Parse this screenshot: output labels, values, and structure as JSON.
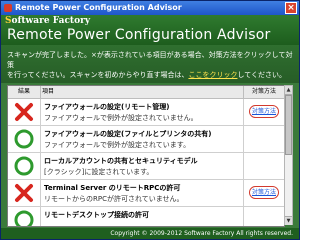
{
  "window": {
    "title": "Remote Power Configuration Advisor",
    "close_glyph": "×"
  },
  "header": {
    "brand_mark": "S",
    "brand_rest": "oftware Factory",
    "title": "Remote Power Configuration Advisor"
  },
  "intro": {
    "line1": "スキャンが完了しました。×が表示されている項目がある場合、対策方法をクリックして対策",
    "line2_prefix": "を行ってください。スキャンを初めからやり直す場合は、",
    "link": "ここをクリック",
    "line2_suffix": "してください。"
  },
  "table": {
    "headers": {
      "result": "結果",
      "item": "項目",
      "action": "対策方法"
    },
    "rows": [
      {
        "status": "fail",
        "name": "ファイアウォールの設定(リモート管理)",
        "detail": "ファイアウォールで例外が設定されていません。",
        "action": "対策方法"
      },
      {
        "status": "ok",
        "name": "ファイアウォールの設定(ファイルとプリンタの共有)",
        "detail": "ファイアウォールで例外が設定されています。",
        "action": ""
      },
      {
        "status": "ok",
        "name": "ローカルアカウントの共有とセキュリティモデル",
        "detail": "[クラシック]に設定されています。",
        "action": ""
      },
      {
        "status": "fail",
        "name": "Terminal Server のリモートRPCの許可",
        "detail": "リモートからのRPCが許可されていません。",
        "action": "対策方法"
      },
      {
        "status": "ok",
        "name": "リモートデスクトップ接続の許可",
        "detail": "",
        "action": ""
      }
    ]
  },
  "footer": {
    "copyright": "Copyright © 2009-2012 Software Factory All rights reserved."
  },
  "colors": {
    "fail": "#d7261e",
    "ok": "#2e9a2e",
    "brand_green": "#2f7a2f"
  }
}
